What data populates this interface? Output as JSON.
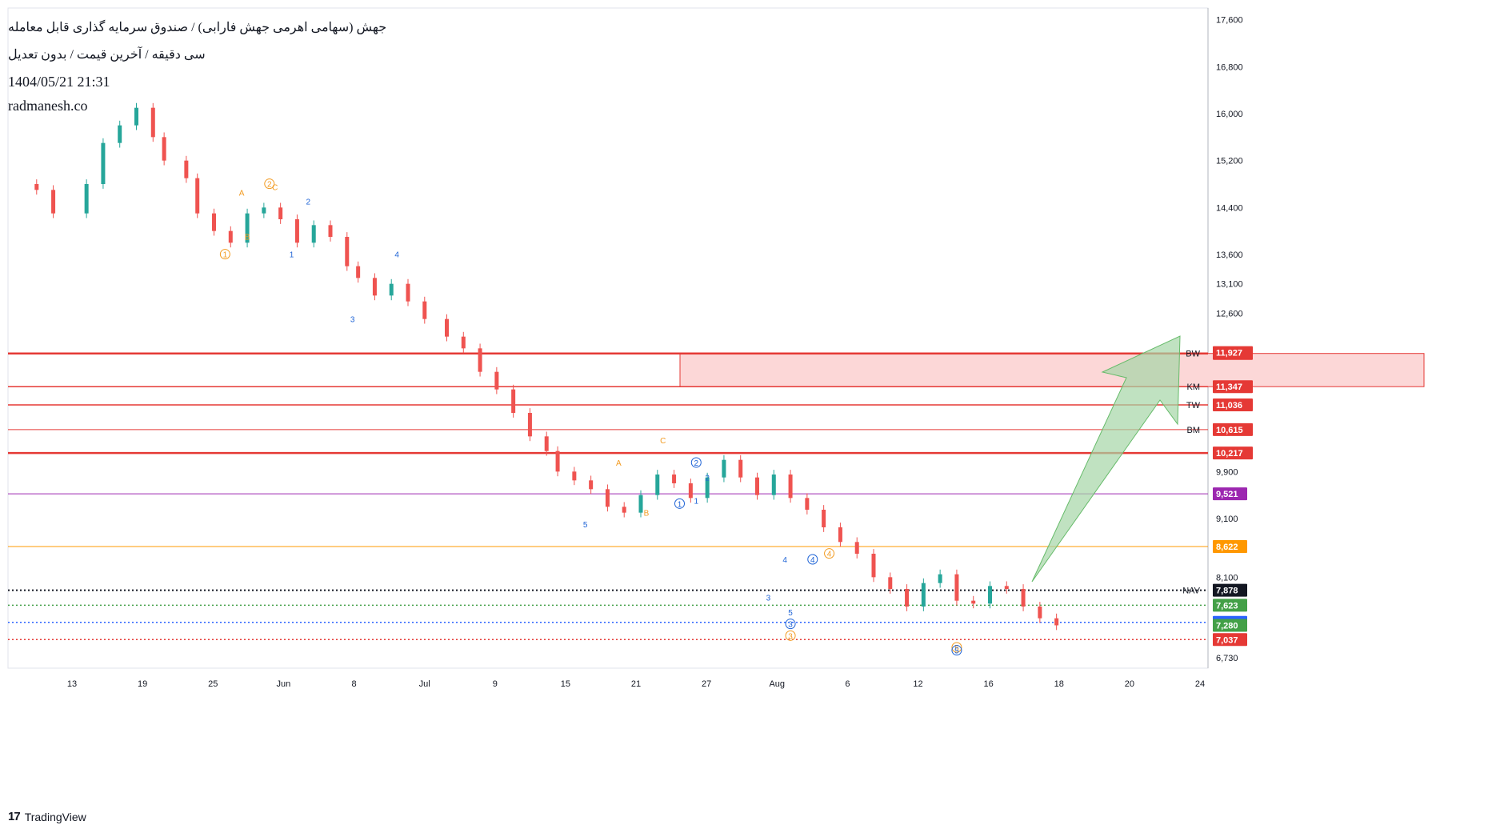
{
  "header": {
    "symbol_title": "جهش (سهامی اهرمی جهش فارابی) / صندوق سرمایه گذاری قابل معامله",
    "subtitle": "سی دقیقه / آخرین قیمت / بدون تعدیل",
    "datetime": "1404/05/21 21:31",
    "site": "radmanesh.co"
  },
  "footer": {
    "brand": "TradingView",
    "logo_glyph": "17"
  },
  "colors": {
    "up": "#26a69a",
    "down": "#ef5350",
    "red_line": "#e53935",
    "zone_fill": "#fcd7d7",
    "purple": "#9c27b0",
    "orange": "#ff9800",
    "green": "#43a047",
    "blue": "#2962ff",
    "black": "#131722",
    "arrow_fill": "#a5d6a7",
    "arrow_stroke": "#66bb6a",
    "wave_blue": "#1e63d6",
    "wave_orange": "#f29a1f"
  },
  "chart_data": {
    "type": "line",
    "ylim": [
      6550,
      17800
    ],
    "y_ticks": [
      {
        "v": 17600,
        "label": "17,600"
      },
      {
        "v": 16800,
        "label": "16,800"
      },
      {
        "v": 16000,
        "label": "16,000"
      },
      {
        "v": 15200,
        "label": "15,200"
      },
      {
        "v": 14400,
        "label": "14,400"
      },
      {
        "v": 13600,
        "label": "13,600"
      },
      {
        "v": 13100,
        "label": "13,100"
      },
      {
        "v": 12600,
        "label": "12,600"
      },
      {
        "v": 9900,
        "label": "9,900"
      },
      {
        "v": 9100,
        "label": "9,100"
      },
      {
        "v": 8100,
        "label": "8,100"
      },
      {
        "v": 6730,
        "label": "6,730"
      }
    ],
    "x_ticks": [
      "13",
      "19",
      "25",
      "Jun",
      "8",
      "Jul",
      "9",
      "15",
      "21",
      "27",
      "Aug",
      "6",
      "12",
      "16",
      "18",
      "20",
      "24"
    ],
    "levels": [
      {
        "label": "BW",
        "value": 11913,
        "price_label": "11,913",
        "color": "red_line",
        "style": "solid",
        "width": 2.5
      },
      {
        "label": "KM",
        "value": 11347,
        "price_label": "11,347",
        "color": "red_line",
        "style": "solid",
        "width": 1.5
      },
      {
        "label": "TW",
        "value": 11036,
        "price_label": "11,036",
        "color": "red_line",
        "style": "solid",
        "width": 1.5
      },
      {
        "label": "BM",
        "value": 10615,
        "price_label": "10,615",
        "color": "red_line",
        "style": "solid",
        "width": 1
      },
      {
        "label": "",
        "value": 10217,
        "price_label": "10,217",
        "color": "red_line",
        "style": "solid",
        "width": 2.5
      },
      {
        "label": "",
        "value": 9521,
        "price_label": "9,521",
        "color": "purple",
        "style": "solid",
        "width": 1
      },
      {
        "label": "",
        "value": 8622,
        "price_label": "8,622",
        "color": "orange",
        "style": "solid",
        "width": 1
      },
      {
        "label": "NAV",
        "value": 7878,
        "price_label": "7,878",
        "color": "black",
        "style": "dotted",
        "width": 2
      },
      {
        "label": "",
        "value": 7623,
        "price_label": "7,623",
        "color": "green",
        "style": "dotted",
        "width": 1.5
      },
      {
        "label": "",
        "value": 7330,
        "price_label": "7,330",
        "color": "blue",
        "style": "dotted",
        "width": 1.5
      },
      {
        "label": "",
        "value": 7037,
        "price_label": "7,037",
        "color": "red_line",
        "style": "dotted",
        "width": 1.5
      }
    ],
    "extra_price_tags": [
      {
        "value": 11927,
        "label": "11,927",
        "color": "red_line"
      },
      {
        "value": 7280,
        "label": "7,280",
        "color": "green"
      }
    ],
    "price_series": [
      {
        "x": 0,
        "y": 14800
      },
      {
        "x": 0.3,
        "y": 14700
      },
      {
        "x": 0.6,
        "y": 14300
      },
      {
        "x": 1.2,
        "y": 14800
      },
      {
        "x": 1.5,
        "y": 15500
      },
      {
        "x": 1.8,
        "y": 15800
      },
      {
        "x": 2.1,
        "y": 16100
      },
      {
        "x": 2.4,
        "y": 15600
      },
      {
        "x": 2.6,
        "y": 15200
      },
      {
        "x": 3.0,
        "y": 14900
      },
      {
        "x": 3.2,
        "y": 14300
      },
      {
        "x": 3.5,
        "y": 14000
      },
      {
        "x": 3.8,
        "y": 13800
      },
      {
        "x": 4.1,
        "y": 14300
      },
      {
        "x": 4.4,
        "y": 14400
      },
      {
        "x": 4.7,
        "y": 14200
      },
      {
        "x": 5.0,
        "y": 13800
      },
      {
        "x": 5.3,
        "y": 14100
      },
      {
        "x": 5.6,
        "y": 13900
      },
      {
        "x": 5.9,
        "y": 13400
      },
      {
        "x": 6.1,
        "y": 13200
      },
      {
        "x": 6.4,
        "y": 12900
      },
      {
        "x": 6.7,
        "y": 13100
      },
      {
        "x": 7.0,
        "y": 12800
      },
      {
        "x": 7.3,
        "y": 12500
      },
      {
        "x": 7.7,
        "y": 12200
      },
      {
        "x": 8.0,
        "y": 12000
      },
      {
        "x": 8.3,
        "y": 11600
      },
      {
        "x": 8.6,
        "y": 11300
      },
      {
        "x": 8.9,
        "y": 10900
      },
      {
        "x": 9.2,
        "y": 10500
      },
      {
        "x": 9.5,
        "y": 10250
      },
      {
        "x": 9.7,
        "y": 9900
      },
      {
        "x": 10.0,
        "y": 9750
      },
      {
        "x": 10.3,
        "y": 9600
      },
      {
        "x": 10.6,
        "y": 9300
      },
      {
        "x": 10.9,
        "y": 9200
      },
      {
        "x": 11.2,
        "y": 9500
      },
      {
        "x": 11.5,
        "y": 9850
      },
      {
        "x": 11.8,
        "y": 9700
      },
      {
        "x": 12.1,
        "y": 9450
      },
      {
        "x": 12.4,
        "y": 9800
      },
      {
        "x": 12.7,
        "y": 10100
      },
      {
        "x": 13.0,
        "y": 9800
      },
      {
        "x": 13.3,
        "y": 9500
      },
      {
        "x": 13.6,
        "y": 9850
      },
      {
        "x": 13.9,
        "y": 9450
      },
      {
        "x": 14.2,
        "y": 9250
      },
      {
        "x": 14.5,
        "y": 8950
      },
      {
        "x": 14.8,
        "y": 8700
      },
      {
        "x": 15.1,
        "y": 8500
      },
      {
        "x": 15.4,
        "y": 8100
      },
      {
        "x": 15.7,
        "y": 7900
      },
      {
        "x": 16.0,
        "y": 7600
      },
      {
        "x": 16.3,
        "y": 8000
      },
      {
        "x": 16.6,
        "y": 8150
      },
      {
        "x": 16.9,
        "y": 7700
      },
      {
        "x": 17.2,
        "y": 7650
      },
      {
        "x": 17.5,
        "y": 7950
      },
      {
        "x": 17.8,
        "y": 7900
      },
      {
        "x": 18.1,
        "y": 7600
      },
      {
        "x": 18.4,
        "y": 7400
      },
      {
        "x": 18.7,
        "y": 7280
      }
    ],
    "wave_labels": [
      {
        "text": "A",
        "x": 4.0,
        "y": 14600,
        "color": "wave_orange",
        "circled": false
      },
      {
        "text": "2",
        "x": 4.5,
        "y": 14750,
        "color": "wave_orange",
        "circled": true
      },
      {
        "text": "C",
        "x": 4.6,
        "y": 14700,
        "color": "wave_orange",
        "circled": false
      },
      {
        "text": "B",
        "x": 4.1,
        "y": 13850,
        "color": "wave_orange",
        "circled": false
      },
      {
        "text": "1",
        "x": 3.7,
        "y": 13550,
        "color": "wave_orange",
        "circled": true
      },
      {
        "text": "2",
        "x": 5.2,
        "y": 14450,
        "color": "wave_blue",
        "circled": false
      },
      {
        "text": "1",
        "x": 4.9,
        "y": 13550,
        "color": "wave_blue",
        "circled": false
      },
      {
        "text": "4",
        "x": 6.8,
        "y": 13550,
        "color": "wave_blue",
        "circled": false
      },
      {
        "text": "3",
        "x": 6.0,
        "y": 12450,
        "color": "wave_blue",
        "circled": false
      },
      {
        "text": "A",
        "x": 10.8,
        "y": 10000,
        "color": "wave_orange",
        "circled": false
      },
      {
        "text": "C",
        "x": 11.6,
        "y": 10380,
        "color": "wave_orange",
        "circled": false
      },
      {
        "text": "B",
        "x": 11.3,
        "y": 9150,
        "color": "wave_orange",
        "circled": false
      },
      {
        "text": "5",
        "x": 10.2,
        "y": 8950,
        "color": "wave_blue",
        "circled": false
      },
      {
        "text": "2",
        "x": 12.2,
        "y": 10000,
        "color": "wave_blue",
        "circled": true
      },
      {
        "text": "2",
        "x": 12.4,
        "y": 9750,
        "color": "wave_blue",
        "circled": false
      },
      {
        "text": "1",
        "x": 11.9,
        "y": 9300,
        "color": "wave_blue",
        "circled": true
      },
      {
        "text": "1",
        "x": 12.2,
        "y": 9350,
        "color": "wave_blue",
        "circled": false
      },
      {
        "text": "4",
        "x": 13.8,
        "y": 8350,
        "color": "wave_blue",
        "circled": false
      },
      {
        "text": "4",
        "x": 14.3,
        "y": 8350,
        "color": "wave_blue",
        "circled": true
      },
      {
        "text": "4",
        "x": 14.6,
        "y": 8450,
        "color": "wave_orange",
        "circled": true
      },
      {
        "text": "3",
        "x": 13.5,
        "y": 7700,
        "color": "wave_blue",
        "circled": false
      },
      {
        "text": "5",
        "x": 13.9,
        "y": 7450,
        "color": "wave_blue",
        "circled": false
      },
      {
        "text": "3",
        "x": 13.9,
        "y": 7250,
        "color": "wave_blue",
        "circled": true
      },
      {
        "text": "3",
        "x": 13.9,
        "y": 7050,
        "color": "wave_orange",
        "circled": true
      },
      {
        "text": "5",
        "x": 16.9,
        "y": 6850,
        "color": "wave_orange",
        "circled": true
      },
      {
        "text": "5",
        "x": 16.9,
        "y": 6800,
        "color": "wave_blue",
        "circled": true
      }
    ]
  }
}
